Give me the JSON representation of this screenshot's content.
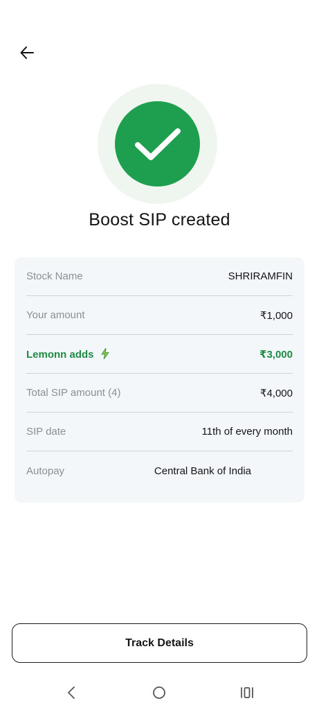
{
  "header": {
    "back_icon": "arrow-left-icon"
  },
  "status": {
    "icon": "check-circle-icon",
    "title": "Boost SIP created",
    "accent": "#1e9e4f"
  },
  "details": {
    "rows": [
      {
        "label": "Stock Name",
        "value": "SHRIRAMFIN"
      },
      {
        "label": "Your amount",
        "value": "₹1,000"
      },
      {
        "label": "Lemonn adds",
        "value": "₹3,000",
        "icon": "bolt-icon"
      },
      {
        "label": "Total SIP amount (4)",
        "value": "₹4,000"
      },
      {
        "label": "SIP date",
        "value": "11th of every month"
      },
      {
        "label": "Autopay",
        "value": "Central Bank of India"
      }
    ]
  },
  "footer": {
    "track_label": "Track Details"
  },
  "system_nav": {
    "back": "nav-back-icon",
    "home": "nav-home-icon",
    "recents": "nav-recents-icon"
  }
}
